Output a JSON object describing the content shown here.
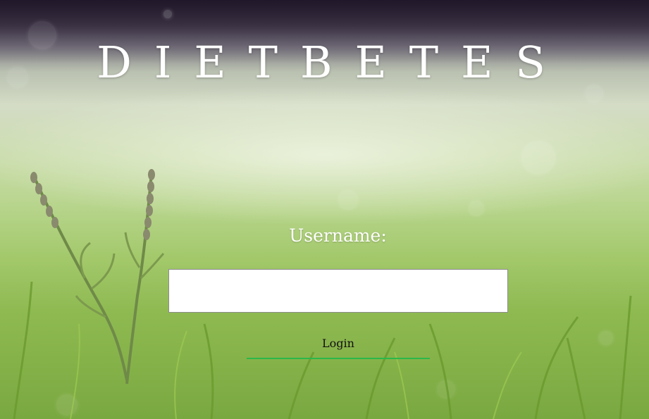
{
  "app": {
    "title": "DIETBETES"
  },
  "login_form": {
    "username_label": "Username:",
    "username_value": "",
    "username_placeholder": "",
    "login_label": "Login"
  },
  "colors": {
    "title_text": "#ffffff",
    "label_text": "#ffffff",
    "input_background": "#ffffff",
    "input_border": "#8c8c8c",
    "button_text": "#111111",
    "button_underline": "#2db84a"
  }
}
